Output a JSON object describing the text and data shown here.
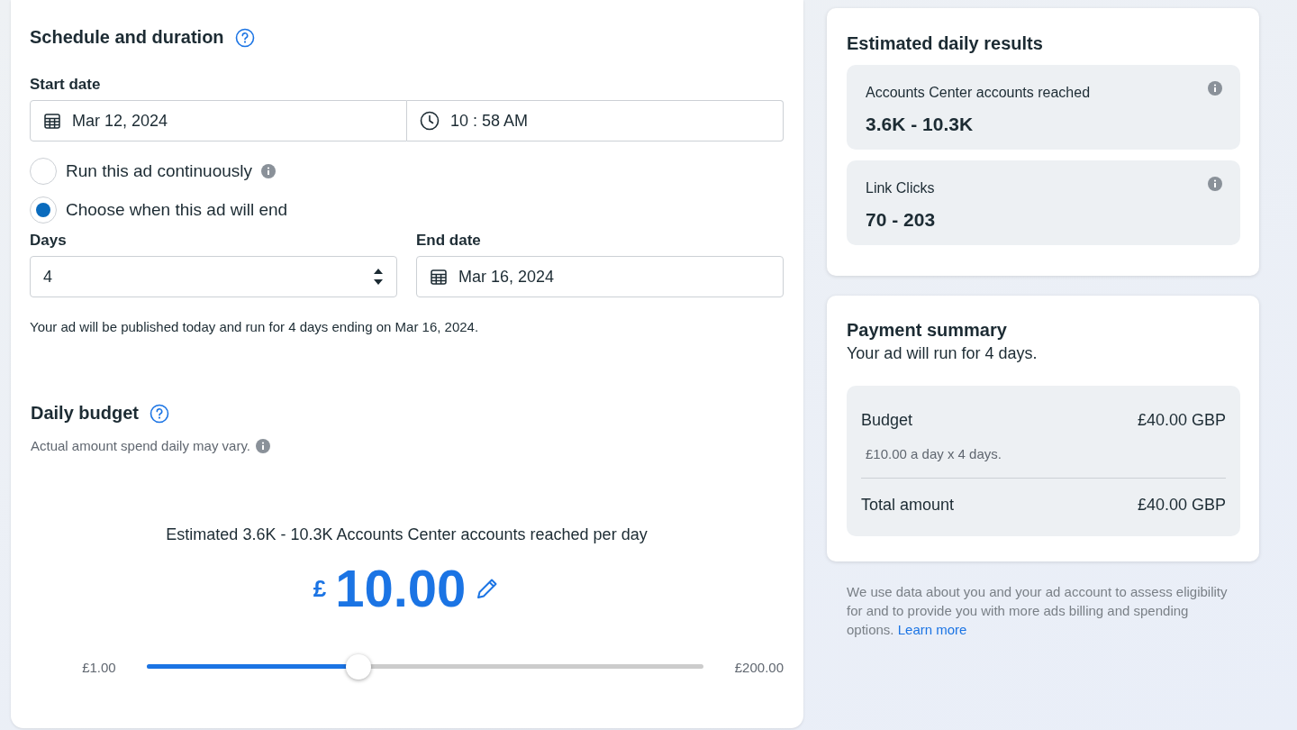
{
  "schedule": {
    "title": "Schedule and duration",
    "start_date_label": "Start date",
    "start_date": "Mar 12, 2024",
    "start_time": "10 : 58 AM",
    "end_options": [
      {
        "label": "Run this ad continuously",
        "selected": false,
        "info": true
      },
      {
        "label": "Choose when this ad will end",
        "selected": true,
        "info": false
      }
    ],
    "days_label": "Days",
    "days": "4",
    "end_date_label": "End date",
    "end_date": "Mar 16, 2024",
    "note": "Your ad will be published today and run for 4 days ending on Mar 16, 2024."
  },
  "budget": {
    "title": "Daily budget",
    "subtitle": "Actual amount spend daily may vary.",
    "estimate": "Estimated 3.6K - 10.3K Accounts Center accounts reached per day",
    "currency": "£",
    "amount": "10.00",
    "min": "£1.00",
    "max": "£200.00",
    "level": 0.38
  },
  "results": {
    "title": "Estimated daily results",
    "metrics": [
      {
        "label": "Accounts Center accounts reached",
        "value": "3.6K - 10.3K"
      },
      {
        "label": "Link Clicks",
        "value": "70 - 203"
      }
    ]
  },
  "payment": {
    "title": "Payment summary",
    "subtitle": "Your ad will run for 4 days.",
    "rows": [
      {
        "label": "Budget",
        "value": "£40.00 GBP",
        "detail": "£10.00 a day x 4 days."
      },
      {
        "label": "Total amount",
        "value": "£40.00 GBP"
      }
    ]
  },
  "disclaimer": {
    "text": "We use data about you and your ad account to assess eligibility for and to provide you with more ads billing and spending options.",
    "link": "Learn more"
  }
}
